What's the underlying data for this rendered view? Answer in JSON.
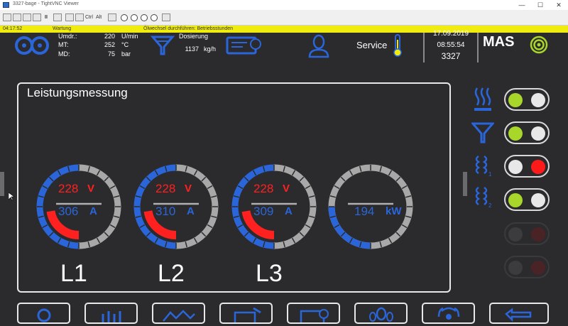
{
  "window": {
    "title": "3327-bage - TightVNC Viewer"
  },
  "toolbar": {
    "ctrl_label": "Ctrl",
    "alt_label": "Alt"
  },
  "status": {
    "time": "04:17:52",
    "category": "Wartung",
    "message": "Ölwechsel durchführen: Betriebsstunden"
  },
  "header": {
    "umdr_label": "Umdr.:",
    "umdr_value": "220",
    "umdr_unit": "U/min",
    "mt_label": "MT:",
    "mt_value": "252",
    "mt_unit": "°C",
    "md_label": "MD:",
    "md_value": "75",
    "md_unit": "bar",
    "dosierung_label": "Dosierung",
    "dosierung_value": "1137",
    "dosierung_unit": "kg/h",
    "service_label": "Service",
    "date": "17.09.2019",
    "time": "08:55:54",
    "machine_no": "3327",
    "logo_text": "MAS"
  },
  "panel": {
    "title": "Leistungsmessung",
    "gauges": [
      {
        "phase": "L1",
        "voltage": "228",
        "voltage_unit": "V",
        "current": "306",
        "current_unit": "A",
        "fill": 0.45
      },
      {
        "phase": "L2",
        "voltage": "228",
        "voltage_unit": "V",
        "current": "310",
        "current_unit": "A",
        "fill": 0.45
      },
      {
        "phase": "L3",
        "voltage": "228",
        "voltage_unit": "V",
        "current": "309",
        "current_unit": "A",
        "fill": 0.45
      }
    ],
    "power": {
      "value": "194",
      "unit": "kW",
      "fill": 0.5
    }
  },
  "status_indicators": [
    {
      "icon": "heating-icon",
      "left": "green",
      "right": "off"
    },
    {
      "icon": "dosing-funnel-icon",
      "left": "green",
      "right": "off"
    },
    {
      "icon": "motor1-icon",
      "left": "off",
      "right": "red"
    },
    {
      "icon": "motor2-icon",
      "left": "green",
      "right": "off"
    },
    {
      "icon": "",
      "left": "dim",
      "right": "dim-red"
    },
    {
      "icon": "",
      "left": "dim",
      "right": "dim-red"
    }
  ],
  "colors": {
    "accent": "#2a66d9",
    "voltage": "#ff2020",
    "green": "#a8d62a",
    "red": "#ff1a1a",
    "status_yellow": "#f0ec10"
  }
}
